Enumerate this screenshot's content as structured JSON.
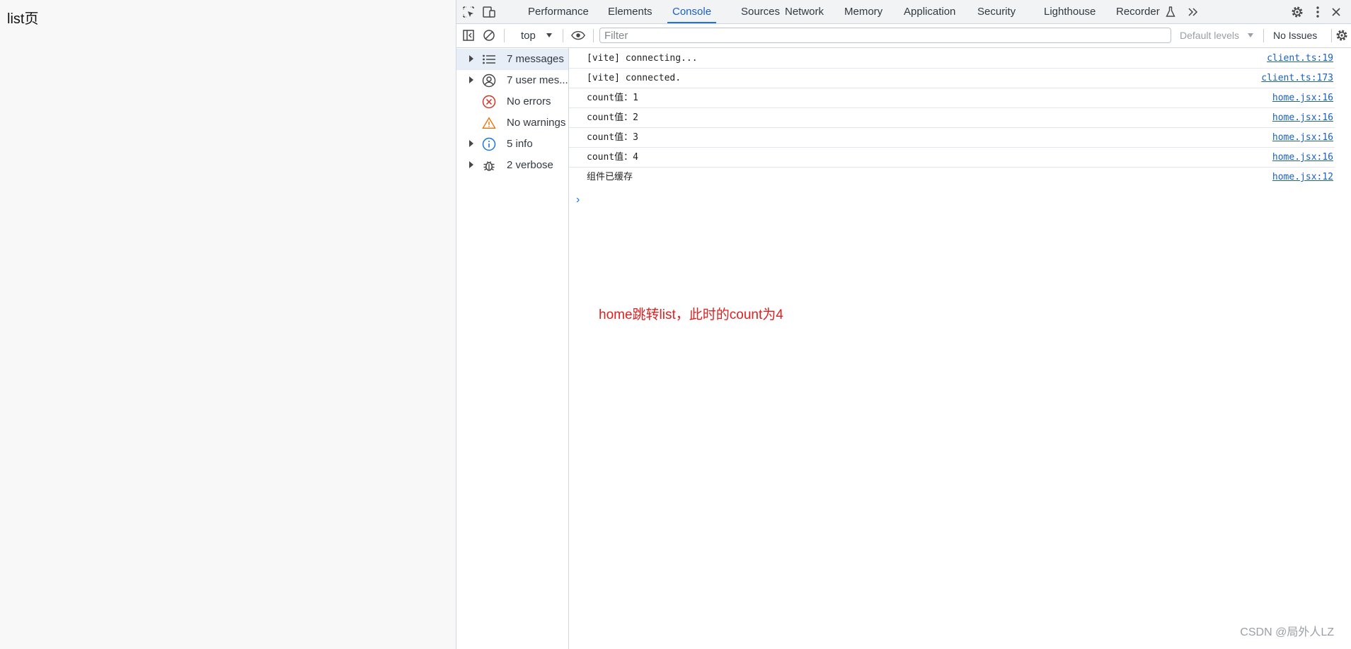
{
  "page": {
    "title": "list页"
  },
  "devtools": {
    "toolbar": {
      "tabs": [
        {
          "label": "Performance"
        },
        {
          "label": "Elements"
        },
        {
          "label": "Console"
        },
        {
          "label": "Sources"
        },
        {
          "label": "Network"
        },
        {
          "label": "Memory"
        },
        {
          "label": "Application"
        },
        {
          "label": "Security"
        },
        {
          "label": "Lighthouse"
        },
        {
          "label": "Recorder"
        }
      ],
      "active_tab": "Console",
      "icons": [
        "inspect-element-icon",
        "device-toolbar-icon",
        "flask-icon",
        "more-tabs-icon",
        "settings-icon",
        "more-options-icon",
        "close-icon"
      ]
    },
    "filterbar": {
      "context": "top",
      "filter_placeholder": "Filter",
      "levels": "Default levels",
      "issues": "No Issues",
      "icons": [
        "sidebar-toggle-icon",
        "clear-console-icon",
        "dropdown-triangle-icon",
        "live-expression-eye-icon",
        "console-settings-icon"
      ]
    },
    "sidebar": {
      "items": [
        {
          "label": "7 messages",
          "icon": "list-icon",
          "expandable": true
        },
        {
          "label": "7 user mes...",
          "icon": "user-icon",
          "expandable": true
        },
        {
          "label": "No errors",
          "icon": "error-icon",
          "expandable": false
        },
        {
          "label": "No warnings",
          "icon": "warning-icon",
          "expandable": false
        },
        {
          "label": "5 info",
          "icon": "info-icon",
          "expandable": true
        },
        {
          "label": "2 verbose",
          "icon": "bug-icon",
          "expandable": true
        }
      ]
    },
    "console": {
      "messages": [
        {
          "text": "[vite] connecting...",
          "source": "client.ts:19"
        },
        {
          "text": "[vite] connected.",
          "source": "client.ts:173"
        },
        {
          "text": "count值：1",
          "source": "home.jsx:16"
        },
        {
          "text": "count值：2",
          "source": "home.jsx:16"
        },
        {
          "text": "count值：3",
          "source": "home.jsx:16"
        },
        {
          "text": "count值：4",
          "source": "home.jsx:16"
        },
        {
          "text": "组件已缓存",
          "source": "home.jsx:12"
        }
      ],
      "prompt": "›"
    }
  },
  "annotation": "home跳转list，此时的count为4",
  "watermark": "CSDN @局外人LZ",
  "colors": {
    "accent": "#1a73e8",
    "annotation": "#e01f1f",
    "error": "#d93025",
    "warning": "#e8710a",
    "link": "#1a5fc7"
  }
}
